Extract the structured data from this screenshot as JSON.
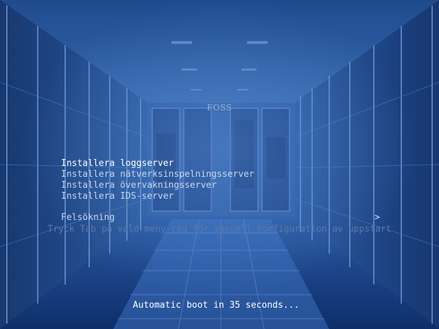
{
  "title": "FOSS",
  "menu": {
    "items": [
      {
        "label": "Installera loggserver"
      },
      {
        "label": "Installera nätverksinspelningsserver"
      },
      {
        "label": "Installera övervakningsserver"
      },
      {
        "label": "Installera IDS-server"
      }
    ],
    "submenu": {
      "label": "Felsökning",
      "chevron": ">"
    }
  },
  "hint": "Tryck Tab på vald meny-rad för manuell konfiguration av uppstart",
  "countdown": "Automatic boot in 35 seconds...",
  "colors": {
    "background": "#0b2a66",
    "text": "#c8d6ee",
    "selected_text": "#ffffff",
    "hint_text": "#5d78a8"
  }
}
